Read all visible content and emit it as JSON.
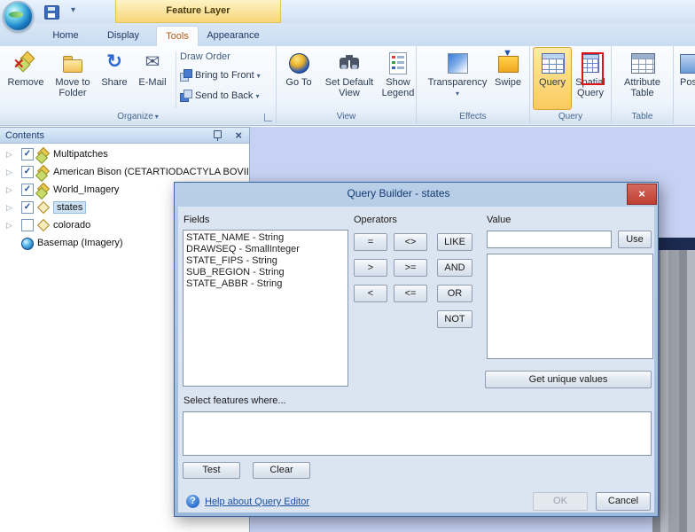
{
  "icons": {
    "close": "×",
    "dropdown": "▾",
    "expand": "▷",
    "check": "✓",
    "email": "✉",
    "share": "↻",
    "remove_x": "✕",
    "help": "?",
    "swipe_arrow": "▼"
  },
  "titlebar": {
    "contextual_tab": "Feature Layer",
    "active_tab": "Tools",
    "tabs": [
      {
        "label": "Home"
      },
      {
        "label": "Display"
      },
      {
        "label": "Tools"
      },
      {
        "label": "Appearance"
      }
    ]
  },
  "ribbon": {
    "organize": {
      "label": "Organize",
      "remove": "Remove",
      "move_to_folder": "Move to Folder",
      "share": "Share",
      "email": "E-Mail",
      "draw_order_title": "Draw Order",
      "bring_to_front": "Bring to Front",
      "send_to_back": "Send to Back"
    },
    "view": {
      "label": "View",
      "go_to": "Go To",
      "set_default_view": "Set Default View",
      "show_legend": "Show Legend"
    },
    "effects": {
      "label": "Effects",
      "transparency": "Transparency",
      "swipe": "Swipe"
    },
    "query": {
      "label": "Query",
      "query_button": "Query",
      "spatial_query": "Spatial Query"
    },
    "table": {
      "label": "Table",
      "attribute_table": "Attribute Table"
    },
    "partial_button": "Pos"
  },
  "contents": {
    "title": "Contents",
    "items": [
      {
        "label": "Multipatches",
        "checked": true
      },
      {
        "label": "American Bison (CETARTIODACTYLA BOVIDAE E",
        "checked": true
      },
      {
        "label": "World_Imagery",
        "checked": true
      },
      {
        "label": "states",
        "checked": true,
        "selected": true
      },
      {
        "label": "colorado",
        "checked": false
      },
      {
        "label": "Basemap (Imagery)"
      }
    ]
  },
  "dialog": {
    "title": "Query Builder - states",
    "fields_label": "Fields",
    "fields": [
      "STATE_NAME - String",
      "DRAWSEQ - SmallInteger",
      "STATE_FIPS - String",
      "SUB_REGION - String",
      "STATE_ABBR - String"
    ],
    "operators_label": "Operators",
    "operators": [
      "=",
      "<>",
      "LIKE",
      ">",
      ">=",
      "AND",
      "<",
      "<=",
      "OR",
      "NOT"
    ],
    "value_label": "Value",
    "value_input": "",
    "use_button": "Use",
    "get_unique_values_button": "Get unique values",
    "where_label": "Select features where...",
    "where_text": "",
    "test_button": "Test",
    "clear_button": "Clear",
    "help_link": "Help about Query Editor",
    "ok_button": "OK",
    "cancel_button": "Cancel"
  }
}
